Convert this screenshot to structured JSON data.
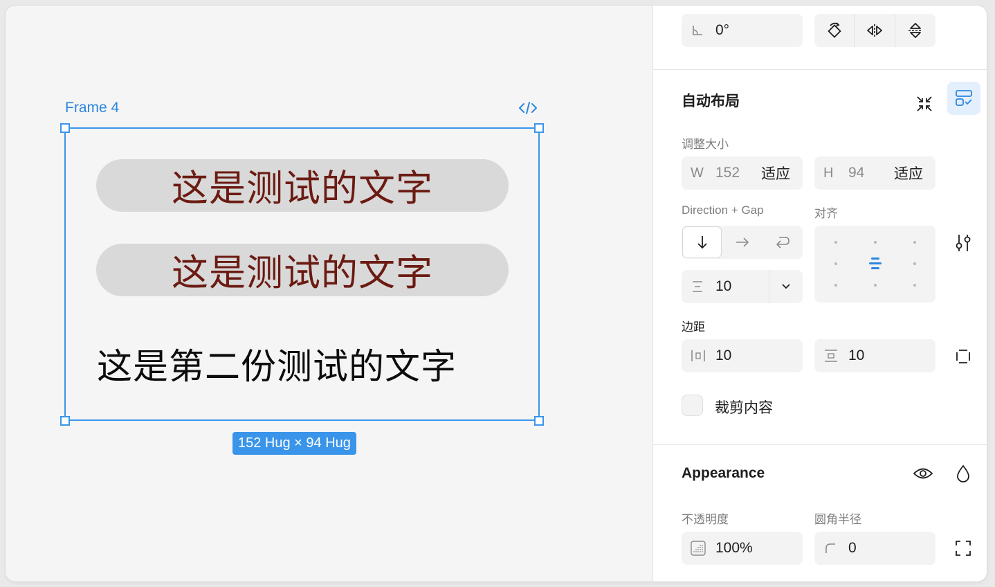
{
  "canvas": {
    "frame_label": "Frame 4",
    "items": [
      {
        "text": "这是测试的文字"
      },
      {
        "text": "这是测试的文字"
      },
      {
        "text": "这是第二份测试的文字"
      }
    ],
    "size_badge": "152 Hug × 94 Hug"
  },
  "panel": {
    "rotation": {
      "value": "0°"
    },
    "auto_layout": {
      "title": "自动布局",
      "resize_label": "调整大小",
      "width": {
        "prefix": "W",
        "value": "152",
        "mode": "适应"
      },
      "height": {
        "prefix": "H",
        "value": "94",
        "mode": "适应"
      },
      "direction_label": "Direction + Gap",
      "align_label": "对齐",
      "gap": {
        "value": "10"
      },
      "padding_label": "边距",
      "padding_horizontal": {
        "value": "10"
      },
      "padding_vertical": {
        "value": "10"
      },
      "clip_label": "裁剪内容"
    },
    "appearance": {
      "title": "Appearance",
      "opacity_label": "不透明度",
      "radius_label": "圆角半径",
      "opacity": {
        "value": "100%"
      },
      "radius": {
        "value": "0"
      }
    }
  },
  "colors": {
    "accent": "#3a95ea",
    "pill_bg": "#d9d9d9",
    "pill_text": "#6b1b12",
    "field_bg": "#f3f3f3"
  }
}
